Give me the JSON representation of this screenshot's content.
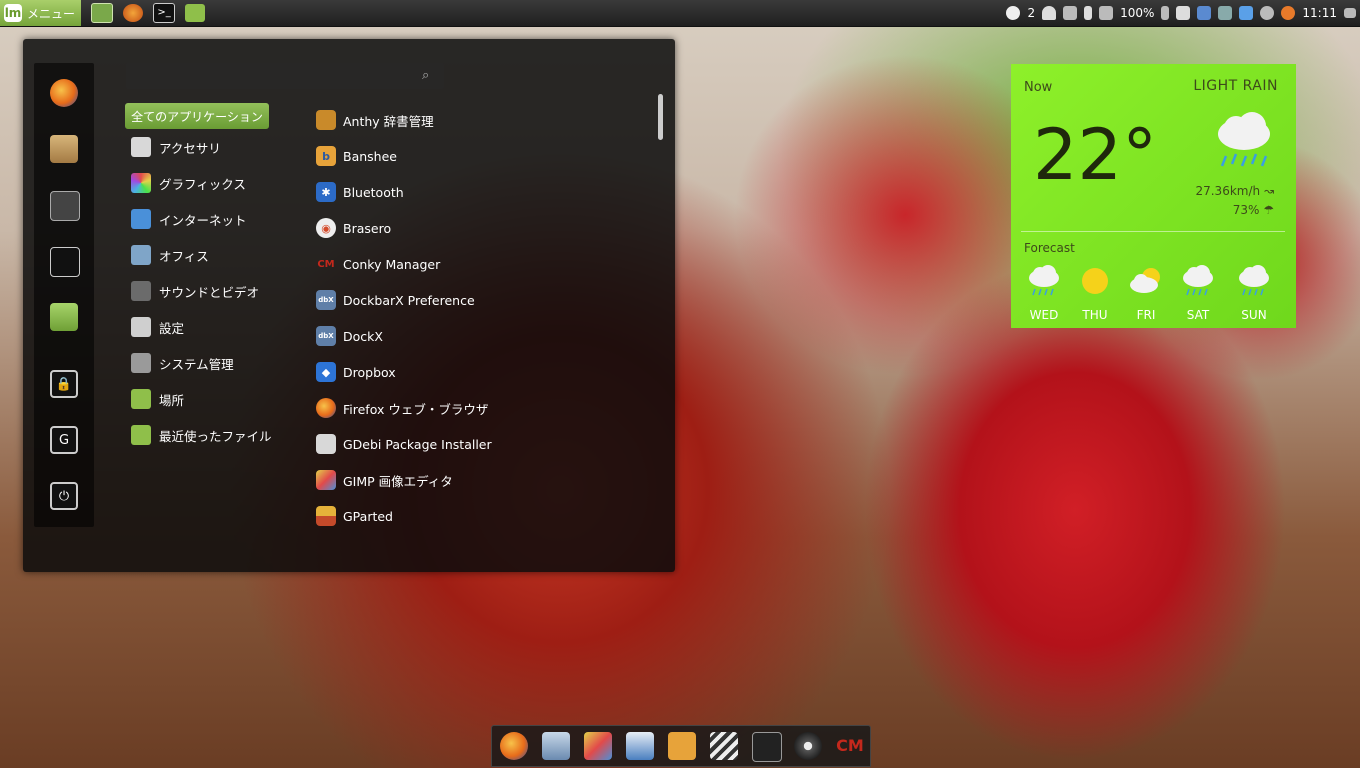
{
  "top_panel": {
    "menu_label": "メニュー",
    "mint_logo": "lm",
    "tray": {
      "notifications": "2",
      "battery": "100%",
      "clock": "11:11"
    }
  },
  "menu": {
    "search": {
      "value": "",
      "placeholder": ""
    },
    "all_apps_label": "全てのアプリケーション",
    "categories": [
      {
        "label": "アクセサリ",
        "icon": "calculator-icon",
        "color": "#d8d8d8"
      },
      {
        "label": "グラフィックス",
        "icon": "graphics-icon",
        "color": "#e24a8f"
      },
      {
        "label": "インターネット",
        "icon": "internet-icon",
        "color": "#4a90d9"
      },
      {
        "label": "オフィス",
        "icon": "office-icon",
        "color": "#7fa5c8"
      },
      {
        "label": "サウンドとビデオ",
        "icon": "multimedia-icon",
        "color": "#6b6b6b"
      },
      {
        "label": "設定",
        "icon": "settings-icon",
        "color": "#cfcfcf"
      },
      {
        "label": "システム管理",
        "icon": "system-icon",
        "color": "#9a9a9a"
      },
      {
        "label": "場所",
        "icon": "folder-icon",
        "color": "#8fbf4a"
      },
      {
        "label": "最近使ったファイル",
        "icon": "recent-folder-icon",
        "color": "#8fbf4a"
      }
    ],
    "apps": [
      {
        "label": "Anthy 辞書管理",
        "icon": "anthy-icon",
        "color": "#c98a2a"
      },
      {
        "label": "Banshee",
        "icon": "banshee-icon",
        "color": "#e7a33a",
        "glyph": "b"
      },
      {
        "label": "Bluetooth",
        "icon": "bluetooth-icon",
        "color": "#2c6bc7",
        "glyph": "✱"
      },
      {
        "label": "Brasero",
        "icon": "brasero-icon",
        "color": "#d44a2a",
        "glyph": "◉"
      },
      {
        "label": "Conky Manager",
        "icon": "conky-icon",
        "color": "#c4281c",
        "glyph": "CM"
      },
      {
        "label": "DockbarX Preference",
        "icon": "dockbarx-icon",
        "color": "#5f7fa8",
        "glyph": "dbX"
      },
      {
        "label": "DockX",
        "icon": "dockx-icon",
        "color": "#5f7fa8",
        "glyph": "dbX"
      },
      {
        "label": "Dropbox",
        "icon": "dropbox-icon",
        "color": "#2d74d6",
        "glyph": "◆"
      },
      {
        "label": "Firefox ウェブ・ブラウザ",
        "icon": "firefox-icon",
        "color": "#e76b1a"
      },
      {
        "label": "GDebi Package Installer",
        "icon": "gdebi-icon",
        "color": "#d8d8d8"
      },
      {
        "label": "GIMP 画像エディタ",
        "icon": "gimp-icon",
        "color": "#c9a16a"
      },
      {
        "label": "GParted",
        "icon": "gparted-icon",
        "color": "#e5b23a"
      }
    ],
    "favorites": [
      {
        "name": "firefox-icon",
        "color": "#e76b1a"
      },
      {
        "name": "software-manager-icon",
        "color": "#b9925a"
      },
      {
        "name": "control-center-icon",
        "color": "#555555"
      },
      {
        "name": "terminal-icon",
        "color": "#222222"
      },
      {
        "name": "home-folder-icon",
        "color": "#8fbf4a"
      }
    ],
    "system_buttons": [
      {
        "name": "lock-screen-icon",
        "glyph": "🔒"
      },
      {
        "name": "logout-icon",
        "glyph": "G"
      },
      {
        "name": "power-icon",
        "glyph": "⏻"
      }
    ]
  },
  "weather": {
    "now_label": "Now",
    "condition": "LIGHT RAIN",
    "temperature": "22°",
    "wind": "27.36km/h",
    "humidity": "73%",
    "forecast_label": "Forecast",
    "forecast": [
      {
        "day": "WED",
        "icon": "rain-icon"
      },
      {
        "day": "THU",
        "icon": "sun-icon"
      },
      {
        "day": "FRI",
        "icon": "partly-cloudy-icon"
      },
      {
        "day": "SAT",
        "icon": "rain-icon"
      },
      {
        "day": "SUN",
        "icon": "rain-icon"
      }
    ]
  },
  "dock": [
    {
      "name": "firefox-icon",
      "color": "#e76b1a"
    },
    {
      "name": "mail-icon",
      "color": "#8aa8c8"
    },
    {
      "name": "gimp-icon",
      "color": "#d9a36b"
    },
    {
      "name": "document-viewer-icon",
      "color": "#4a7fc0"
    },
    {
      "name": "banshee-icon",
      "color": "#e7a33a"
    },
    {
      "name": "video-editor-icon",
      "color": "#d0d0d0"
    },
    {
      "name": "system-monitor-icon",
      "color": "#333333"
    },
    {
      "name": "brasero-icon",
      "color": "#555555"
    },
    {
      "name": "conky-icon",
      "color": "#c4281c"
    }
  ]
}
